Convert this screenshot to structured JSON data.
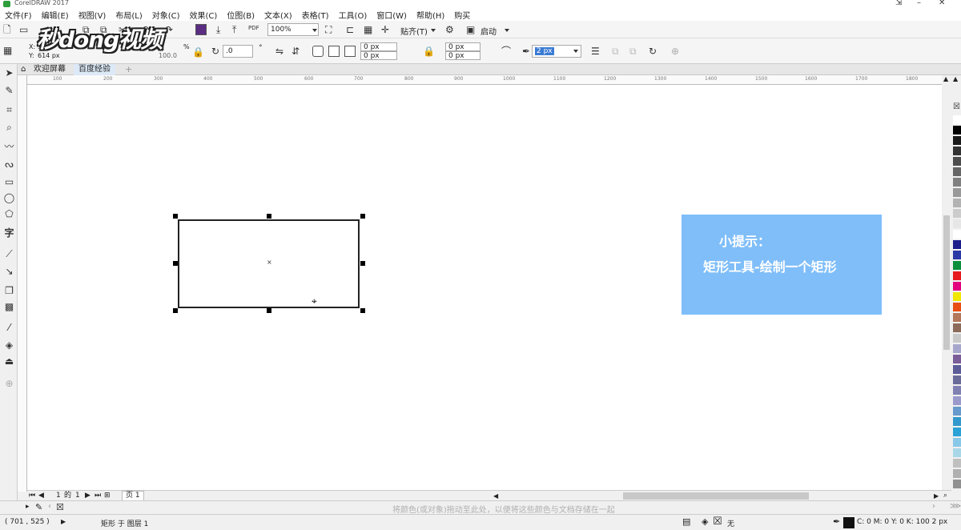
{
  "window": {
    "title": "CorelDRAW 2017"
  },
  "menu": [
    "文件(F)",
    "编辑(E)",
    "视图(V)",
    "布局(L)",
    "对象(C)",
    "效果(C)",
    "位图(B)",
    "文本(X)",
    "表格(T)",
    "工具(O)",
    "窗口(W)",
    "帮助(H)",
    "购买"
  ],
  "toolbar": {
    "zoom": "100%",
    "snap_label": "贴齐(T)",
    "launch_label": "启动",
    "pdf_label": "PDF"
  },
  "props": {
    "x_label": "X:",
    "x_value": "52",
    "y_label": "Y:",
    "y_value": "614 px",
    "scale_value": "100.0",
    "scale_unit": "%",
    "rotation": ".0",
    "corner_tl": "0 px",
    "corner_bl": "0 px",
    "corner_tr": "0 px",
    "corner_br": "0 px",
    "outline_width": "2 px"
  },
  "watermark": {
    "text": "秒dong视频"
  },
  "tabs": [
    "欢迎屏幕",
    "百度经验"
  ],
  "ruler_ticks": [
    "100",
    "200",
    "300",
    "400",
    "500",
    "600",
    "700",
    "800",
    "900",
    "1000",
    "1100",
    "1200",
    "1300",
    "1400",
    "1500",
    "1600",
    "1700",
    "1800"
  ],
  "tip": {
    "title": "小提示：",
    "text": "矩形工具-绘制一个矩形"
  },
  "pager": {
    "current": "1",
    "of": "的",
    "total": "1",
    "page_tab": "页 1"
  },
  "colorbar_hint": "将颜色(或对象)拖动至此处，以便将这些颜色与文档存储在一起",
  "status": {
    "coords": "( 701 , 525 )",
    "object_info": "矩形 于 图层 1",
    "fill_none": "无",
    "outline_info": "C: 0 M: 0 Y: 0 K: 100  2 px"
  },
  "palette_colors": [
    "#ffffff",
    "#000000",
    "#1a1a1a",
    "#333333",
    "#4d4d4d",
    "#666666",
    "#808080",
    "#999999",
    "#b3b3b3",
    "#cccccc",
    "#e6e6e6",
    "#ffffff",
    "#1c1c8c",
    "#2b39a6",
    "#0b8f3c",
    "#e6191f",
    "#e3007f",
    "#f0e600",
    "#e84d12",
    "#b3765a",
    "#8c6a5a",
    "#c9c9c9",
    "#a6a6cc",
    "#7a5c99",
    "#5c5c99",
    "#6b6b99",
    "#8080b3",
    "#9999cc",
    "#6699cc",
    "#3399cc",
    "#2aa2d6",
    "#88c8e8",
    "#a8d8e8",
    "#c0c0c0",
    "#b0b0b0",
    "#909090"
  ]
}
